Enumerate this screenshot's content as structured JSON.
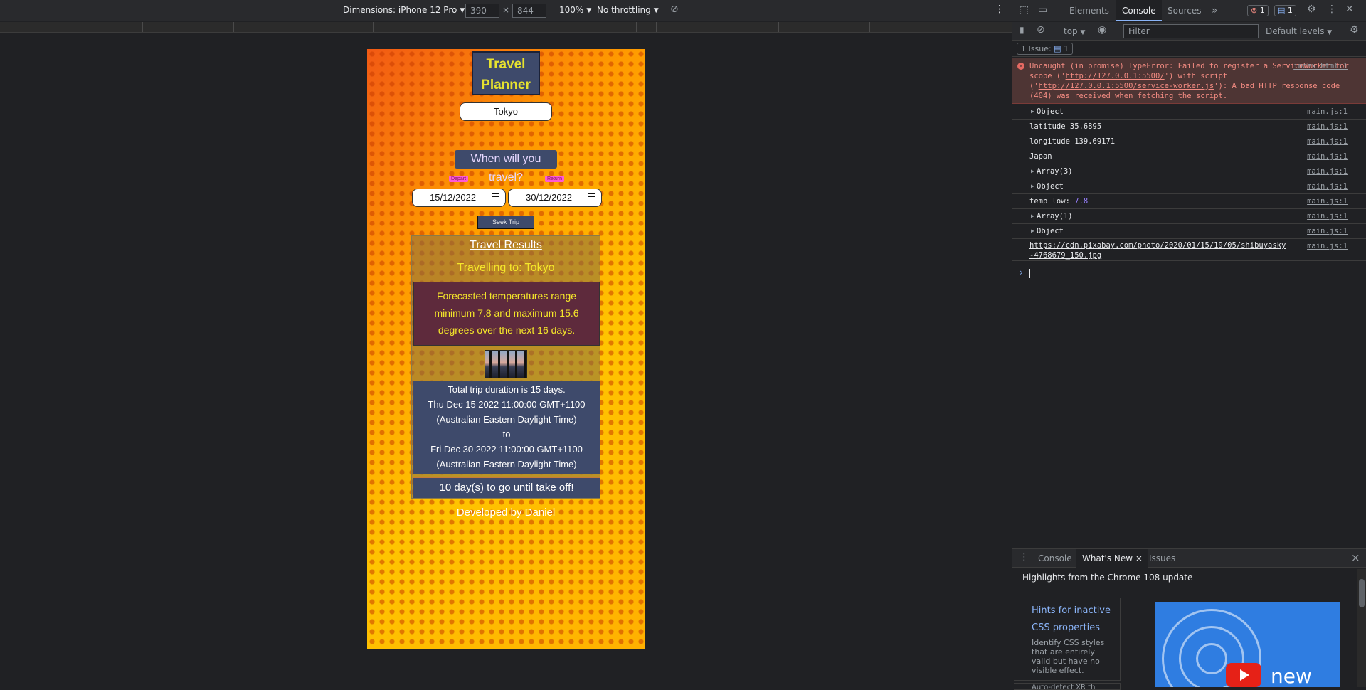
{
  "device_toolbar": {
    "dimensions_label": "Dimensions: iPhone 12 Pro",
    "width": "390",
    "times": "×",
    "height": "844",
    "zoom": "100%",
    "throttling": "No throttling"
  },
  "app": {
    "title_line1": "Travel",
    "title_line2": "Planner",
    "city_value": "Tokyo",
    "question": "When will you travel?",
    "depart_label": "Depart",
    "return_label": "Return",
    "depart_date": "15/12/2022",
    "return_date": "30/12/2022",
    "seek_button": "Seek Trip",
    "results": {
      "heading": "Travel Results",
      "destination": "Travelling to: Tokyo",
      "forecast": "Forecasted temperatures range minimum 7.8 and maximum 15.6 degrees over the next 16 days.",
      "duration_line": "Total trip duration is 15 days.",
      "start_date": "Thu Dec 15 2022 11:00:00 GMT+1100 (Australian Eastern Daylight Time)",
      "to": "to",
      "end_date": "Fri Dec 30 2022 11:00:00 GMT+1100 (Australian Eastern Daylight Time)",
      "countdown": "10 day(s) to go until take off!"
    },
    "footer": "Developed by Daniel"
  },
  "devtools": {
    "tabs": [
      "Elements",
      "Console",
      "Sources"
    ],
    "more_tabs": "»",
    "error_count": "1",
    "message_count": "1",
    "context": "top",
    "filter_placeholder": "Filter",
    "levels": "Default levels",
    "issues_label": "1 Issue:",
    "issues_count": "1",
    "error": {
      "text_a": "Uncaught (in promise) TypeError: Failed to register a ServiceWorker for scope ('",
      "link_a": "http://127.0.0.1:5500/",
      "text_b": "') with script ('",
      "link_b": "http://127.0.0.1:5500/service-worker.js",
      "text_c": "'): A bad HTTP response code (404) was received when fetching the script.",
      "source": "index.html:1"
    },
    "logs": [
      {
        "text": "Object",
        "expandable": true,
        "source": "main.js:1"
      },
      {
        "text": "latitude 35.6895",
        "expandable": false,
        "source": "main.js:1"
      },
      {
        "text": "longitude 139.69171",
        "expandable": false,
        "source": "main.js:1"
      },
      {
        "text": "Japan",
        "expandable": false,
        "source": "main.js:1"
      },
      {
        "text": "Array(3)",
        "expandable": true,
        "source": "main.js:1"
      },
      {
        "text": "Object",
        "expandable": true,
        "source": "main.js:1"
      },
      {
        "text": "temp low:",
        "value": "7.8",
        "expandable": false,
        "source": "main.js:1"
      },
      {
        "text": "Array(1)",
        "expandable": true,
        "source": "main.js:1"
      },
      {
        "text": "Object",
        "expandable": true,
        "source": "main.js:1"
      }
    ],
    "url_log": {
      "line1": "https://cdn.pixabay.com/photo/2020/01/15/19/05/shibuyasky",
      "line2": "-4768679_150.jpg",
      "source": "main.js:1"
    },
    "prompt": "›",
    "drawer": {
      "tabs": [
        "Console",
        "What's New",
        "Issues"
      ],
      "close_tab": "×",
      "close": "×",
      "highlight": "Highlights from the Chrome 108 update",
      "card_link1": "Hints for inactive",
      "card_link2": "CSS properties",
      "card_desc": "Identify CSS styles that are entirely valid but have no visible effect.",
      "card_more": "Auto-detect XR th",
      "video_text": "new"
    }
  }
}
